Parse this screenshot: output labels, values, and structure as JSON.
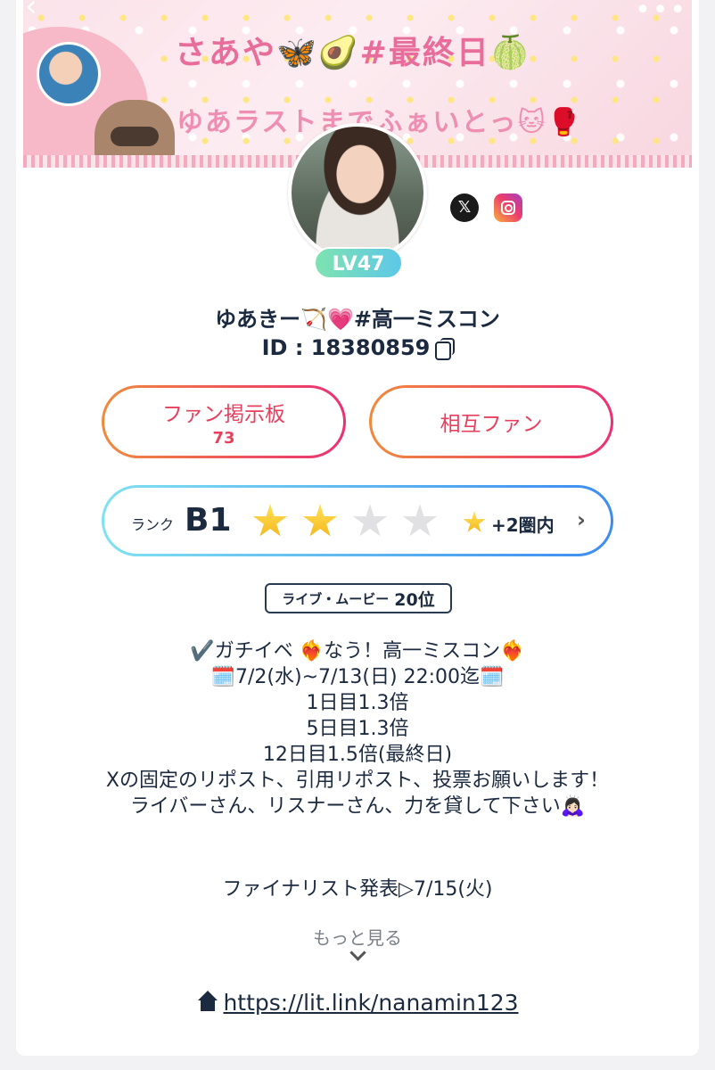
{
  "banner": {
    "line1": "さあや🦋🥑#最終日🍈",
    "line2": "ゆあラストまでふぁいとっ🐱🥊"
  },
  "nav": {
    "back_icon": "chevron-left-icon",
    "more_icon": "more-dots-icon"
  },
  "profile": {
    "level": "LV47",
    "username": "ゆあきー🏹💗#高一ミスコン",
    "id_text": "ID : 18380859",
    "social": [
      "x-icon",
      "instagram-icon"
    ]
  },
  "buttons": {
    "fan_board_label": "ファン掲示板",
    "fan_board_count": "73",
    "mutual_fan_label": "相互ファン"
  },
  "rank": {
    "label": "ランク",
    "value": "B1",
    "stars_filled": 2,
    "stars_total": 4,
    "progress": "+2圏内"
  },
  "category": {
    "label": "ライブ・ムービー",
    "rank": "20位"
  },
  "bio": {
    "lines": [
      "✔️ガチイベ ❤️‍🔥なう！高一ミスコン❤️‍🔥",
      "🗓️7/2(水)~7/13(日) 22:00迄🗓️",
      "1日目1.3倍",
      "5日目1.3倍",
      "12日目1.5倍(最終日)",
      "Xの固定のリポスト、引用リポスト、投票お願いします！",
      "ライバーさん、リスナーさん、力を貸して下さい🙇🏻‍♀️"
    ],
    "extra": "ファイナリスト発表▷7/15(火)"
  },
  "see_more": "もっと見る",
  "link": "https://lit.link/nanamin123",
  "colors": {
    "accent_pink": "#ec2f75",
    "accent_orange": "#f08a3c",
    "rank_blue": "#3d8cf0",
    "level_green": "#7ee3b0"
  }
}
